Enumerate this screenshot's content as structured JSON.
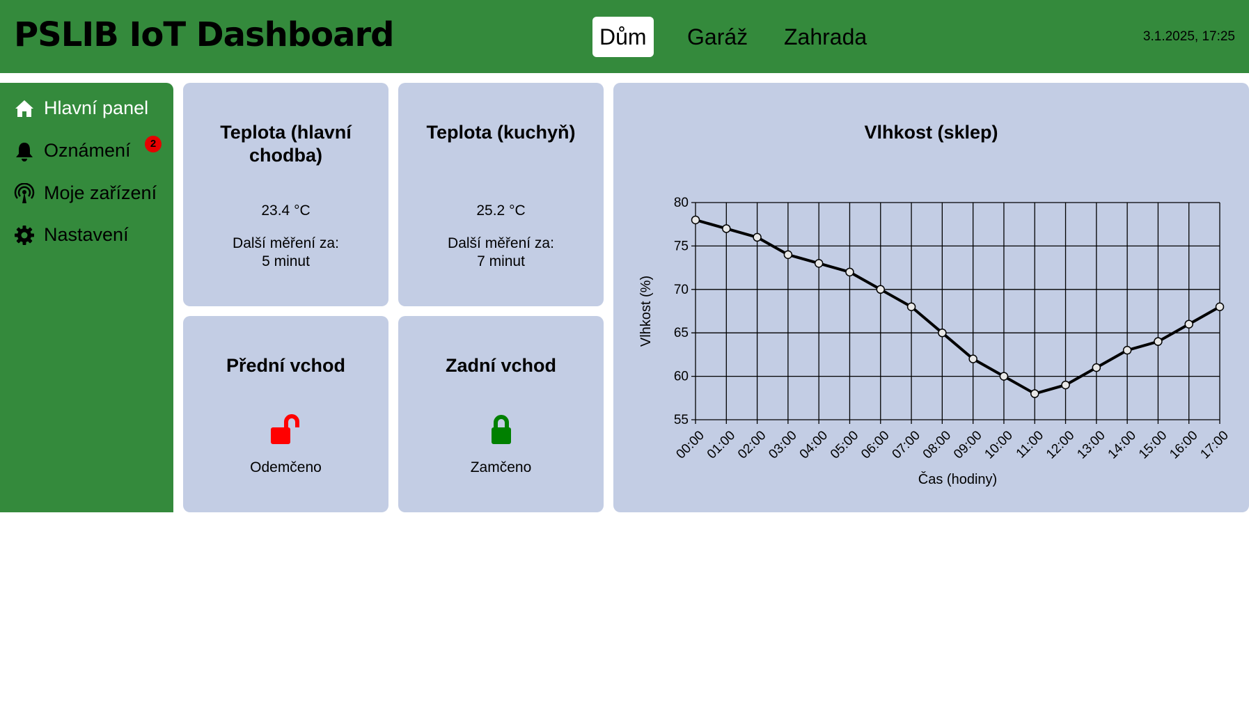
{
  "header": {
    "title": "PSLIB IoT Dashboard",
    "tabs": [
      {
        "label": "Dům",
        "active": true
      },
      {
        "label": "Garáž",
        "active": false
      },
      {
        "label": "Zahrada",
        "active": false
      }
    ],
    "datetime": "3.1.2025, 17:25",
    "color": "#348a3c"
  },
  "sidebar": {
    "items": [
      {
        "label": "Hlavní panel",
        "icon": "home-icon",
        "active": true
      },
      {
        "label": "Oznámení",
        "icon": "bell-icon",
        "badge": "2"
      },
      {
        "label": "Moje zařízení",
        "icon": "antenna-icon"
      },
      {
        "label": "Nastavení",
        "icon": "gear-icon"
      }
    ]
  },
  "cards": {
    "temp_hall": {
      "title_line1": "Teplota (hlavní",
      "title_line2": "chodba)",
      "value": "23.4 °C",
      "next_label": "Další měření za:",
      "next_value": "5 minut"
    },
    "temp_kitchen": {
      "title": "Teplota (kuchyň)",
      "value": "25.2 °C",
      "next_label": "Další měření za:",
      "next_value": "7 minut"
    },
    "front_door": {
      "title": "Přední vchod",
      "status": "Odemčeno",
      "icon": "lock-open-icon",
      "color": "#ff0000"
    },
    "back_door": {
      "title": "Zadní vchod",
      "status": "Zamčeno",
      "icon": "lock-closed-icon",
      "color": "#008000"
    },
    "card_color": "#c3cde4"
  },
  "chart_data": {
    "type": "line",
    "title": "Vlhkost (sklep)",
    "xlabel": "Čas (hodiny)",
    "ylabel": "Vlhkost (%)",
    "categories": [
      "00:00",
      "01:00",
      "02:00",
      "03:00",
      "04:00",
      "05:00",
      "06:00",
      "07:00",
      "08:00",
      "09:00",
      "10:00",
      "11:00",
      "12:00",
      "13:00",
      "14:00",
      "15:00",
      "16:00",
      "17:00"
    ],
    "values": [
      78,
      77,
      76,
      74,
      73,
      72,
      70,
      68,
      65,
      62,
      60,
      58,
      59,
      61,
      63,
      64,
      66,
      68
    ],
    "ylim": [
      55,
      80
    ],
    "yticks": [
      55,
      60,
      65,
      70,
      75,
      80
    ],
    "grid": true,
    "line_color": "#000000"
  }
}
